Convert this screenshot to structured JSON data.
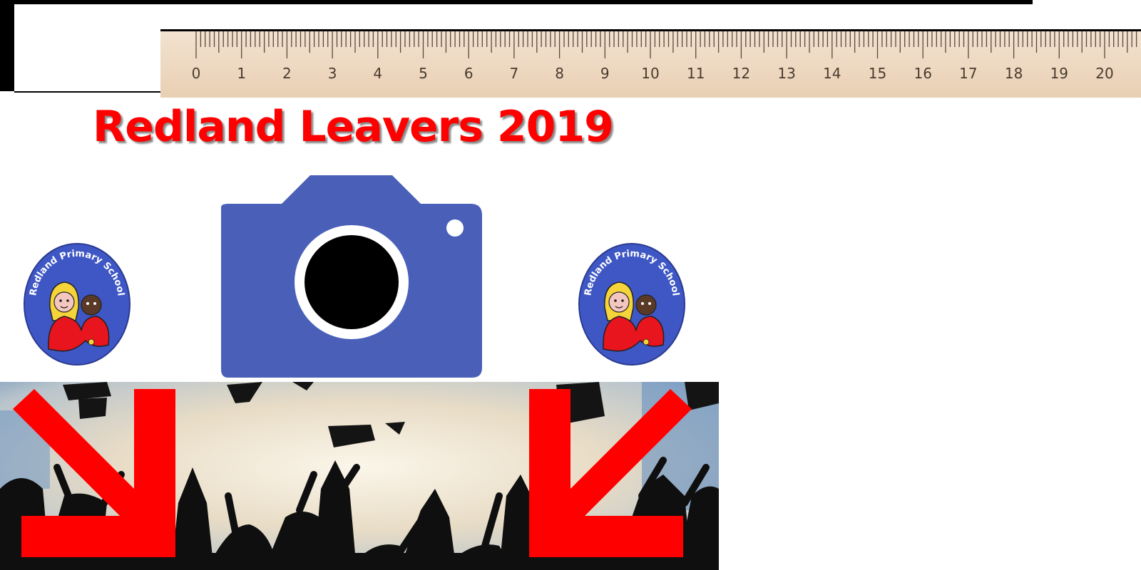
{
  "title": "Redland Leavers 2019",
  "ruler": {
    "labels": [
      "0",
      "1",
      "2",
      "3",
      "4",
      "5",
      "6",
      "7",
      "8",
      "9",
      "10",
      "11",
      "12",
      "13",
      "14",
      "15",
      "16",
      "17",
      "18",
      "19",
      "20"
    ]
  },
  "badge": {
    "text": "Redland Primary School"
  },
  "icons": {
    "camera": "camera-icon",
    "arrow_left": "arrow-down-right-icon",
    "arrow_right": "arrow-down-left-icon"
  },
  "colors": {
    "title_red": "#ff0000",
    "camera_blue": "#4a60b8",
    "badge_blue": "#3f57c4",
    "arrow_red": "#ff0000",
    "ruler_wood": "#edd8c1"
  }
}
